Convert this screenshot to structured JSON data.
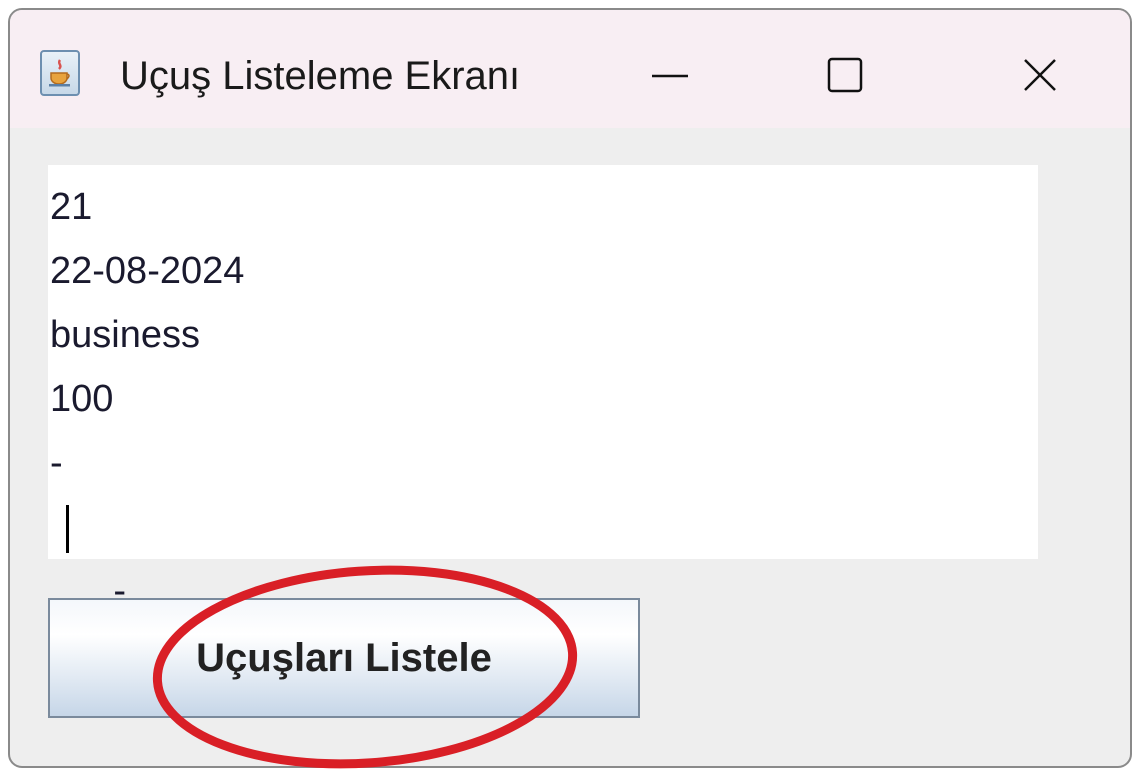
{
  "window": {
    "title": "Uçuş Listeleme Ekranı",
    "titlebar_color": "#f8eef3",
    "body_color": "#eeeeee"
  },
  "controls": {
    "minimize_icon": "minimize-icon",
    "maximize_icon": "maximize-icon",
    "close_icon": "close-icon"
  },
  "textarea": {
    "lines": [
      "21",
      "22-08-2024",
      "business",
      "100",
      "-",
      "-"
    ]
  },
  "button": {
    "label": "Uçuşları Listele"
  },
  "annotation": {
    "color": "#d91f26",
    "shape": "ellipse"
  }
}
